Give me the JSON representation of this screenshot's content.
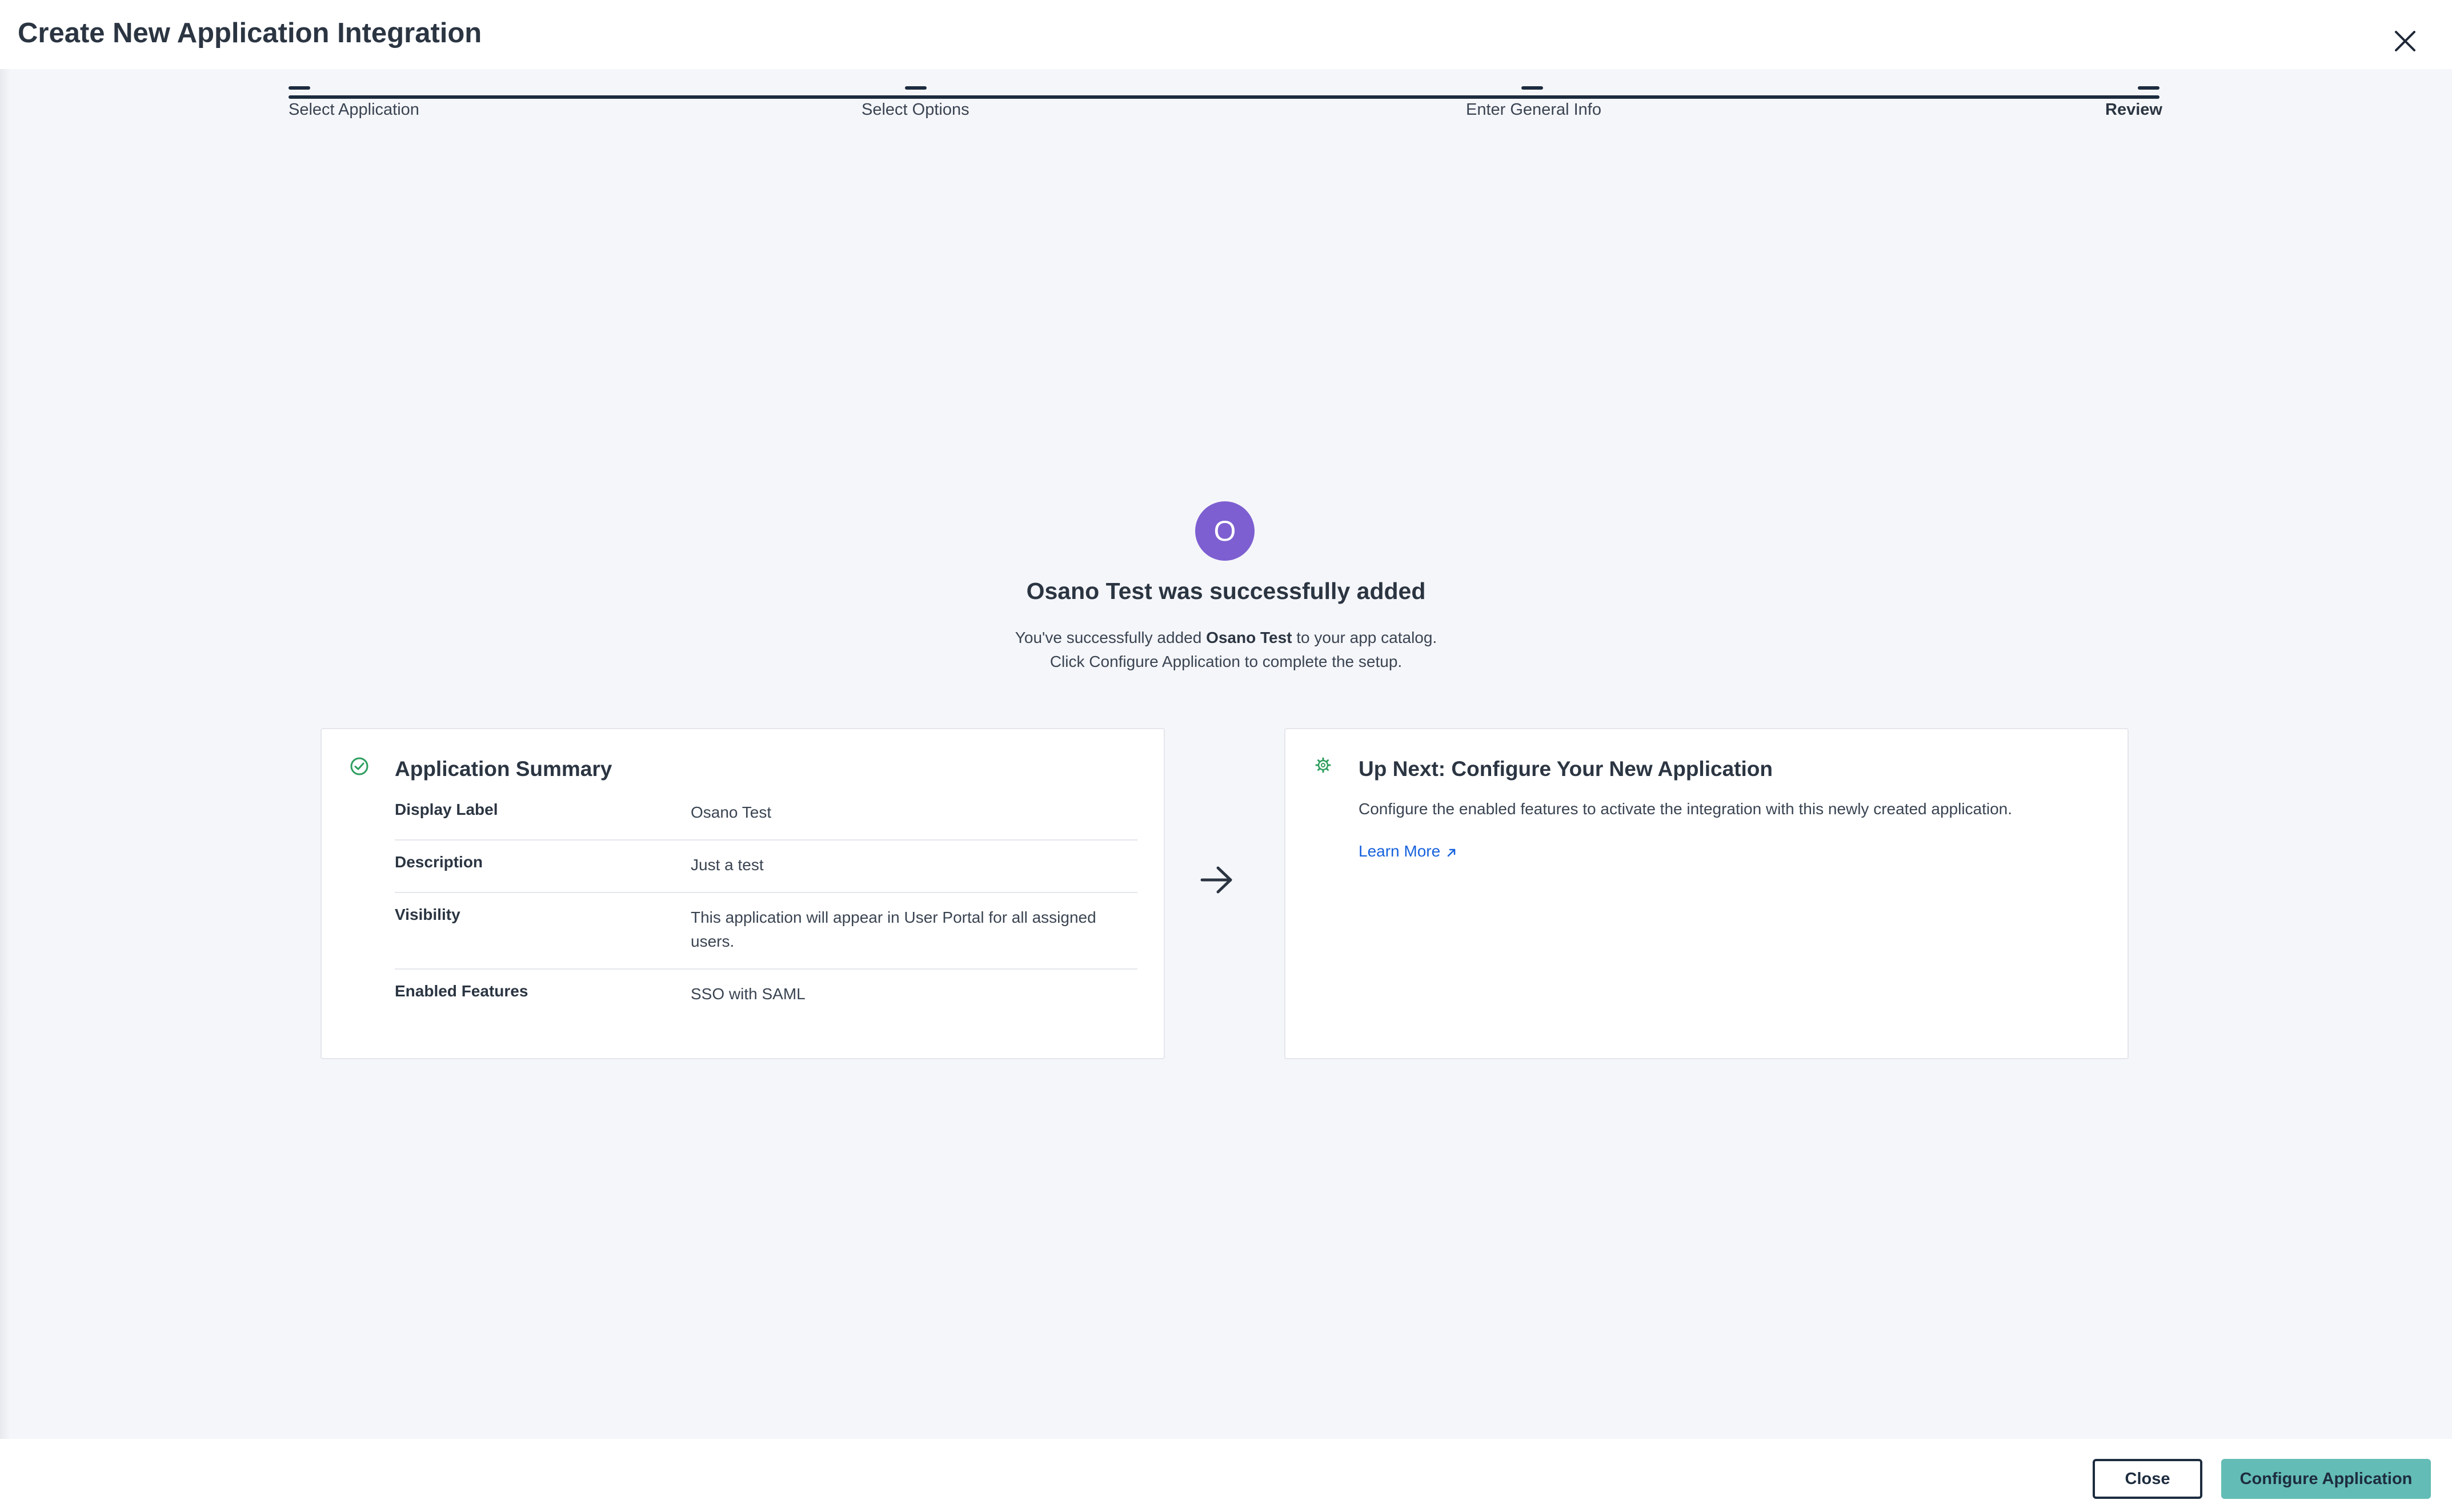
{
  "header": {
    "title": "Create New Application Integration",
    "close_icon": "close-icon"
  },
  "stepper": {
    "steps": [
      {
        "label": "Select Application",
        "active": false
      },
      {
        "label": "Select Options",
        "active": false
      },
      {
        "label": "Enter General Info",
        "active": false
      },
      {
        "label": "Review",
        "active": true
      }
    ]
  },
  "success": {
    "avatar_letter": "O",
    "avatar_color": "#7d5fd1",
    "title": "Osano Test was successfully added",
    "msg_prefix": "You've successfully added ",
    "app_name": "Osano Test",
    "msg_suffix": " to your app catalog.",
    "msg_line2": "Click Configure Application to complete the setup."
  },
  "summary": {
    "icon": "check-circle-icon",
    "title": "Application Summary",
    "rows": [
      {
        "label": "Display Label",
        "value": "Osano Test"
      },
      {
        "label": "Description",
        "value": "Just a test"
      },
      {
        "label": "Visibility",
        "value": "This application will appear in User Portal for all assigned users."
      },
      {
        "label": "Enabled Features",
        "value": "SSO with SAML"
      }
    ]
  },
  "next": {
    "icon": "gear-icon",
    "title": "Up Next: Configure Your New Application",
    "description": "Configure the enabled features to activate the integration with this newly created application.",
    "learn_more": "Learn More"
  },
  "footer": {
    "close_label": "Close",
    "configure_label": "Configure Application"
  },
  "colors": {
    "accent": "#63bcb6",
    "dark": "#1d2c3f",
    "link": "#1662dd",
    "success": "#2e9e5e"
  }
}
